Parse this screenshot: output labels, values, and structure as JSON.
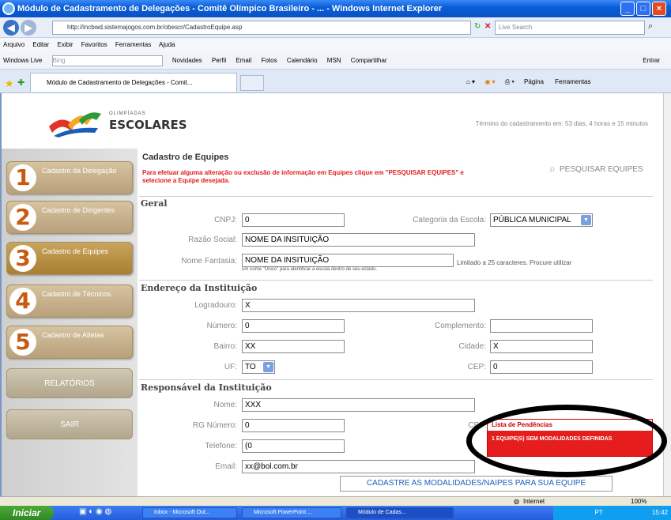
{
  "window": {
    "title": "Módulo de Cadastramento de Delegações - Comitê Olímpico Brasileiro - ... - Windows Internet Explorer",
    "address": "http://incbwd.sistemajogos.com.br/obescr/CadastroEquipe.asp",
    "search_placeholder": "Live Search",
    "tab_title": "Módulo de Cadastramento de Delegações - Comit..."
  },
  "menu": [
    "Arquivo",
    "Editar",
    "Exibir",
    "Favoritos",
    "Ferramentas",
    "Ajuda"
  ],
  "links": [
    "Windows Live",
    "Bing",
    "Novidades",
    "Perfil",
    "Email",
    "Fotos",
    "Calendário",
    "MSN",
    "Compartilhar",
    "Entrar"
  ],
  "commands": {
    "page": "Página",
    "tools": "Ferramentas"
  },
  "header": {
    "logo_top": "OLIMPÍADAS",
    "logo_bottom": "ESCOLARES",
    "remaining": "Término do cadastramento em: 53 dias, 4 horas e 15 minutos"
  },
  "sidebar": {
    "items": [
      {
        "num": "1",
        "label": "Cadastro da Delegação"
      },
      {
        "num": "2",
        "label": "Cadastro de Dirigentes"
      },
      {
        "num": "3",
        "label": "Cadastro de Equipes"
      },
      {
        "num": "4",
        "label": "Cadastro de Técnicos"
      },
      {
        "num": "5",
        "label": "Cadastro de Atletas"
      }
    ],
    "relatorios": "RELATÓRIOS",
    "sair": "SAIR"
  },
  "content": {
    "title": "Cadastro de Equipes",
    "warning": "Para efetuar alguma alteração ou exclusão de informação em Equipes clique em \"PESQUISAR EQUIPES\" e selecione a Equipe desejada.",
    "search_link": "PESQUISAR EQUIPES",
    "sections": {
      "geral": "Geral",
      "endereco": "Endereço da Instituição",
      "responsavel": "Responsável da Instituição"
    },
    "labels": {
      "cnpj": "CNPJ:",
      "categoria": "Categoria da Escola:",
      "razao": "Razão Social:",
      "fantasia": "Nome Fantasia:",
      "logradouro": "Logradouro:",
      "numero": "Número:",
      "complemento": "Complemento:",
      "bairro": "Bairro:",
      "cidade": "Cidade:",
      "uf": "UF:",
      "cep": "CEP:",
      "nome": "Nome:",
      "rg": "RG Número:",
      "cpf": "CPF:",
      "telefone": "Telefone:",
      "email": "Email:"
    },
    "values": {
      "cnpj": "0",
      "categoria": "PÚBLICA MUNICIPAL",
      "razao": "NOME DA INSITUIÇÃO",
      "fantasia": "NOME DA INSITUIÇÃO",
      "logradouro": "X",
      "numero": "0",
      "complemento": "",
      "bairro": "XX",
      "cidade": "X",
      "uf": "TO",
      "cep": "0",
      "nome": "XXX",
      "rg": "0",
      "telefone": "(0",
      "email": "xx@bol.com.br"
    },
    "note_fantasia": "Limitado a 25 caracteres. Procure utilizar",
    "note_fantasia2": "um nome \"Único\" para identificar a escola dentro de seu estado.",
    "cadastre_button": "CADASTRE AS MODALIDADES/NAIPES PARA SUA EQUIPE"
  },
  "pendencias": {
    "title": "Lista de Pendências",
    "text": "1 EQUIPE(S) SEM MODALIDADES DEFINIDAS"
  },
  "statusbar": {
    "zone": "Internet",
    "zoom": "100%"
  },
  "taskbar": {
    "start": "Iniciar",
    "items": [
      "Inbox - Microsoft Out...",
      "Microsoft PowerPoint ...",
      "Módulo de Cadas..."
    ],
    "clock": "15:42",
    "lang": "PT"
  }
}
